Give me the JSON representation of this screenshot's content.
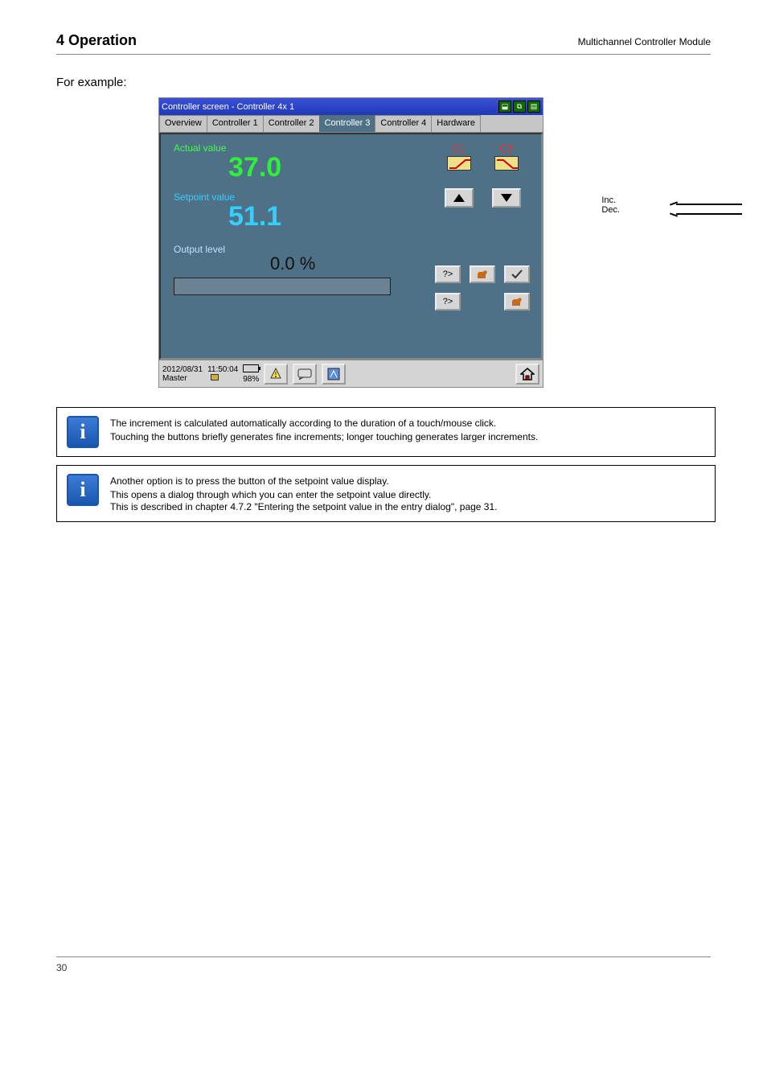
{
  "header": {
    "title": "4 Operation",
    "subtitle": "Multichannel Controller Module"
  },
  "intro": "For example:",
  "app": {
    "title": "Controller screen - Controller 4x 1",
    "tabs": [
      {
        "label": "Overview"
      },
      {
        "label": "Controller 1"
      },
      {
        "label": "Controller 2"
      },
      {
        "label": "Controller 3"
      },
      {
        "label": "Controller 4"
      },
      {
        "label": "Hardware"
      }
    ],
    "active_tab_index": 3,
    "fields": {
      "actual_label": "Actual value",
      "actual_value": "37.0",
      "setpoint_label": "Setpoint value",
      "setpoint_value": "51.1",
      "output_label": "Output level",
      "output_value": "0.0 %"
    },
    "right": {
      "c1": "C1",
      "c2": "C2",
      "sel_auto": "?>",
      "sel_check": "✓"
    },
    "statusbar": {
      "date": "2012/08/31",
      "time": "11:50:04",
      "user": "Master",
      "battery": "98%"
    }
  },
  "callout": {
    "line1": "Inc.",
    "line2": "Dec."
  },
  "info1": {
    "l1": "The increment is calculated automatically according to the duration of a touch/mouse click.",
    "l2": "Touching the buttons briefly generates fine increments; longer touching generates larger increments."
  },
  "info2": {
    "l1": "Another option is to press the button of the setpoint value display.",
    "l2": "This opens a dialog through which you can enter the setpoint value directly.",
    "l3": "This is described in chapter 4.7.2 \"Entering the setpoint value in the entry dialog\", page 31."
  },
  "footer": {
    "page": "30"
  }
}
